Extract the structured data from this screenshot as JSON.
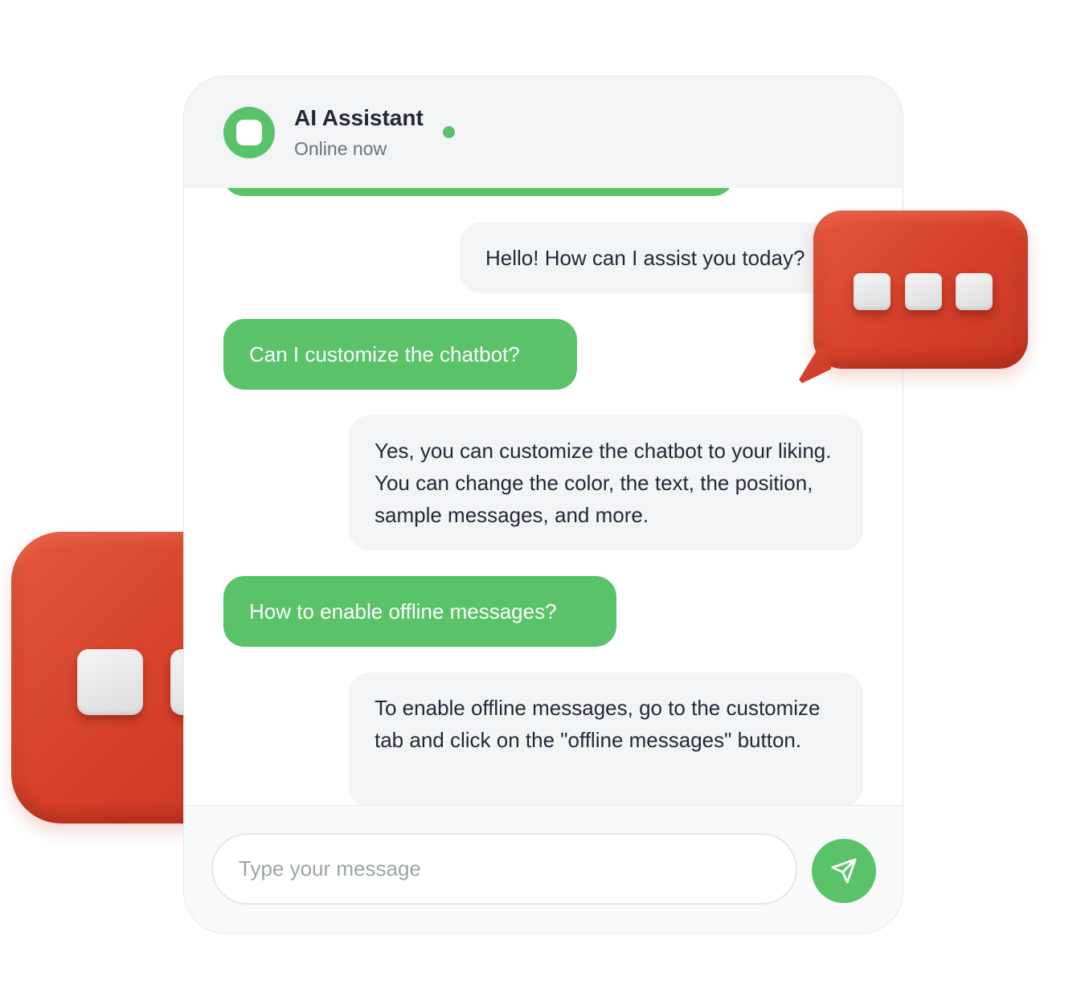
{
  "header": {
    "title": "AI Assistant",
    "status": "Online now",
    "avatar_icon": "chat-bubble-icon"
  },
  "messages": [
    {
      "role": "bot",
      "text": "Hello! How can I assist you today?"
    },
    {
      "role": "user",
      "text": "Can I customize the chatbot?"
    },
    {
      "role": "bot",
      "text": "Yes, you can customize the chatbot to your liking. You can change the color, the text, the position, sample messages, and more."
    },
    {
      "role": "user",
      "text": "How to enable offline messages?"
    },
    {
      "role": "bot",
      "text": "To enable offline messages, go to the customize tab and click on the \"offline messages\" button."
    }
  ],
  "composer": {
    "placeholder": "Type your message",
    "value": "",
    "send_icon": "send-icon"
  },
  "colors": {
    "accent": "#5ac369",
    "bot_bubble": "#f3f4f6",
    "header_bg": "#f3f4f6",
    "decorative_bubble": "#d5402a"
  }
}
